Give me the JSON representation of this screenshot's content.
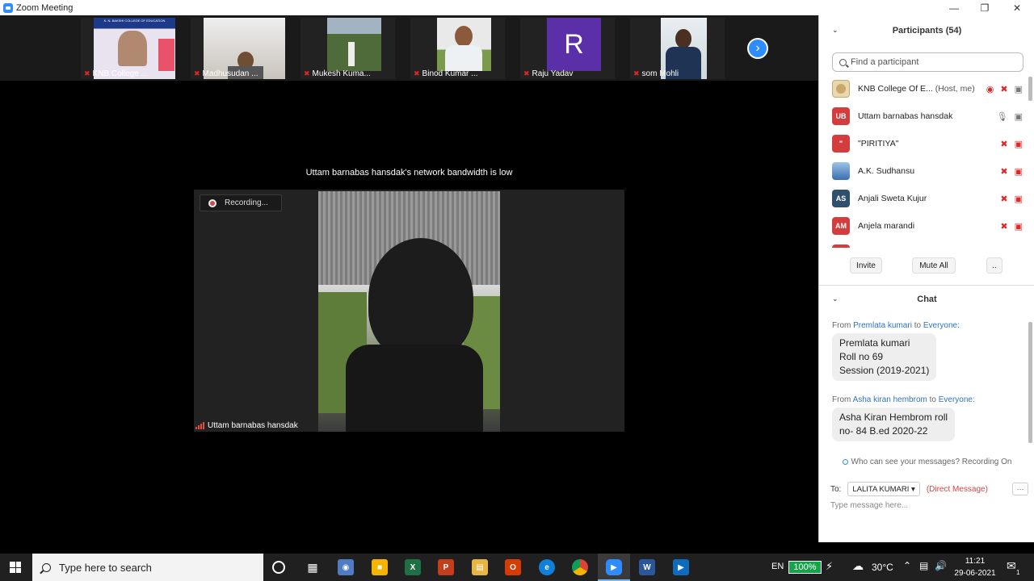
{
  "window": {
    "title": "Zoom Meeting"
  },
  "thumbnails": [
    {
      "name": "KNB College ..."
    },
    {
      "name": "Madhusudan ..."
    },
    {
      "name": "Mukesh Kuma..."
    },
    {
      "name": "Binod Kumar ..."
    },
    {
      "name": "Raju Yadav",
      "avatar_letter": "R",
      "avatar_color": "#5b2fa8"
    },
    {
      "name": "som Mohli"
    }
  ],
  "thumbnail_banner": "K. N. BAKSHI COLLEGE OF EDUCATION",
  "stage": {
    "notice": "Uttam barnabas hansdak's network bandwidth is low",
    "recording": "Recording...",
    "speaker": "Uttam barnabas hansdak"
  },
  "participants": {
    "header": "Participants (54)",
    "search_placeholder": "Find a participant",
    "list": [
      {
        "name": "KNB College Of E...",
        "tag": "(Host, me)",
        "initials": "",
        "color": "#c9a86a"
      },
      {
        "name": "Uttam barnabas hansdak",
        "tag": "",
        "initials": "UB",
        "color": "#d33d3d"
      },
      {
        "name": "\"PIRITIYA\"",
        "tag": "",
        "initials": "\"",
        "color": "#d33d3d"
      },
      {
        "name": "A.K. Sudhansu",
        "tag": "",
        "initials": "",
        "color": "#3a6fb0"
      },
      {
        "name": "Anjali Sweta Kujur",
        "tag": "",
        "initials": "AS",
        "color": "#2f4f6f"
      },
      {
        "name": "Anjela marandi",
        "tag": "",
        "initials": "AM",
        "color": "#d33d3d"
      }
    ],
    "buttons": {
      "invite": "Invite",
      "mute_all": "Mute All",
      "more": ".."
    }
  },
  "chat": {
    "header": "Chat",
    "messages": [
      {
        "from_prefix": "From",
        "from": "Premlata kumari",
        "to_word": "to",
        "to": "Everyone:",
        "text": "Premlata kumari\nRoll no 69\nSession (2019-2021)"
      },
      {
        "from_prefix": "From",
        "from": "Asha kiran hembrom",
        "to_word": "to",
        "to": "Everyone:",
        "text": "Asha Kiran Hembrom roll\nno- 84 B.ed 2020-22"
      }
    ],
    "visibility": "Who can see your messages? Recording On",
    "to_label": "To:",
    "to_value": "LALITA KUMARI",
    "direct": "(Direct Message)",
    "more": "···",
    "input_placeholder": "Type message here..."
  },
  "taskbar": {
    "search_placeholder": "Type here to search",
    "lang": "EN",
    "battery": "100%",
    "temperature": "30°C",
    "time": "11:21",
    "date": "29-06-2021",
    "notification_count": "1"
  }
}
